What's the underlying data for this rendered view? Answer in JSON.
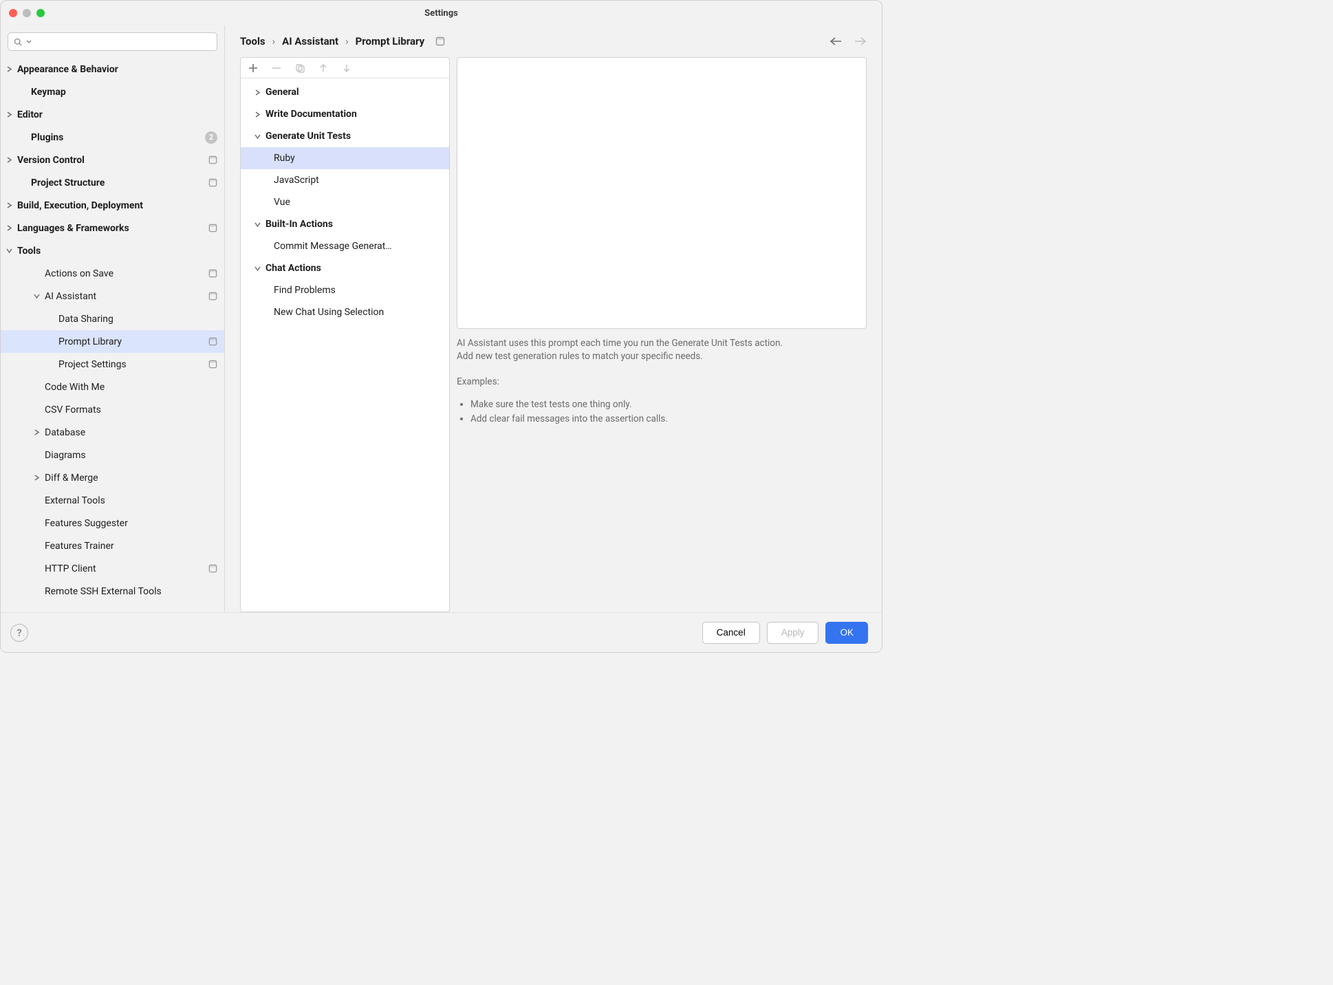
{
  "window": {
    "title": "Settings"
  },
  "search": {
    "placeholder": ""
  },
  "breadcrumbs": {
    "a": "Tools",
    "b": "AI Assistant",
    "c": "Prompt Library"
  },
  "sidebar": {
    "items": [
      {
        "label": "Appearance & Behavior",
        "level": 0,
        "arrow": "right"
      },
      {
        "label": "Keymap",
        "level": 0
      },
      {
        "label": "Editor",
        "level": 0,
        "arrow": "right"
      },
      {
        "label": "Plugins",
        "level": 0,
        "badge": "2"
      },
      {
        "label": "Version Control",
        "level": 0,
        "arrow": "right",
        "proj": true
      },
      {
        "label": "Project Structure",
        "level": 0,
        "proj": true
      },
      {
        "label": "Build, Execution, Deployment",
        "level": 0,
        "arrow": "right"
      },
      {
        "label": "Languages & Frameworks",
        "level": 0,
        "arrow": "right",
        "proj": true
      },
      {
        "label": "Tools",
        "level": 0,
        "arrow": "down"
      },
      {
        "label": "Actions on Save",
        "level": 1,
        "proj": true
      },
      {
        "label": "AI Assistant",
        "level": 1,
        "arrow": "down",
        "proj": true
      },
      {
        "label": "Data Sharing",
        "level": 2
      },
      {
        "label": "Prompt Library",
        "level": 2,
        "selected": true,
        "proj": true
      },
      {
        "label": "Project Settings",
        "level": 2,
        "proj": true
      },
      {
        "label": "Code With Me",
        "level": 1
      },
      {
        "label": "CSV Formats",
        "level": 1
      },
      {
        "label": "Database",
        "level": 1,
        "arrow": "right"
      },
      {
        "label": "Diagrams",
        "level": 1
      },
      {
        "label": "Diff & Merge",
        "level": 1,
        "arrow": "right"
      },
      {
        "label": "External Tools",
        "level": 1
      },
      {
        "label": "Features Suggester",
        "level": 1
      },
      {
        "label": "Features Trainer",
        "level": 1
      },
      {
        "label": "HTTP Client",
        "level": 1,
        "proj": true
      },
      {
        "label": "Remote SSH External Tools",
        "level": 1
      }
    ]
  },
  "tree": {
    "items": [
      {
        "label": "General",
        "level": 0,
        "arrow": "right",
        "bold": true
      },
      {
        "label": "Write Documentation",
        "level": 0,
        "arrow": "right",
        "bold": true
      },
      {
        "label": "Generate Unit Tests",
        "level": 0,
        "arrow": "down",
        "bold": true
      },
      {
        "label": "Ruby",
        "level": 1,
        "selected": true
      },
      {
        "label": "JavaScript",
        "level": 1
      },
      {
        "label": "Vue",
        "level": 1
      },
      {
        "label": "Built-In Actions",
        "level": 0,
        "arrow": "down",
        "bold": true
      },
      {
        "label": "Commit Message Generat…",
        "level": 1
      },
      {
        "label": "Chat Actions",
        "level": 0,
        "arrow": "down",
        "bold": true
      },
      {
        "label": "Find Problems",
        "level": 1
      },
      {
        "label": "New Chat Using Selection",
        "level": 1
      }
    ]
  },
  "desc": {
    "line1": "AI Assistant uses this prompt each time you run the Generate Unit Tests action.",
    "line2": "Add new test generation rules to match your specific needs.",
    "examples_title": "Examples:",
    "ex1": "Make sure the test tests one thing only.",
    "ex2": "Add clear fail messages into the assertion calls."
  },
  "footer": {
    "help": "?",
    "cancel": "Cancel",
    "apply": "Apply",
    "ok": "OK"
  }
}
